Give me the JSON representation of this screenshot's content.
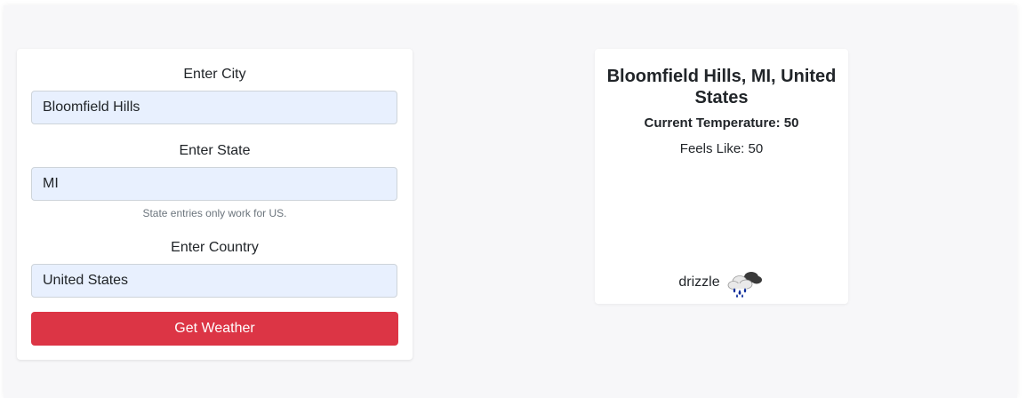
{
  "form": {
    "city": {
      "label": "Enter City",
      "value": "Bloomfield Hills"
    },
    "state": {
      "label": "Enter State",
      "value": "MI",
      "hint": "State entries only work for US."
    },
    "country": {
      "label": "Enter Country",
      "value": "United States"
    },
    "submit_label": "Get Weather"
  },
  "weather": {
    "location": "Bloomfield Hills, MI, United States",
    "current_temperature": "Current Temperature: 50",
    "feels_like": "Feels Like: 50",
    "condition": "drizzle",
    "condition_icon": "drizzle-icon"
  },
  "colors": {
    "button": "#dc3545",
    "input_bg": "#e8f0fe",
    "page_bg": "#f7f7f9"
  }
}
